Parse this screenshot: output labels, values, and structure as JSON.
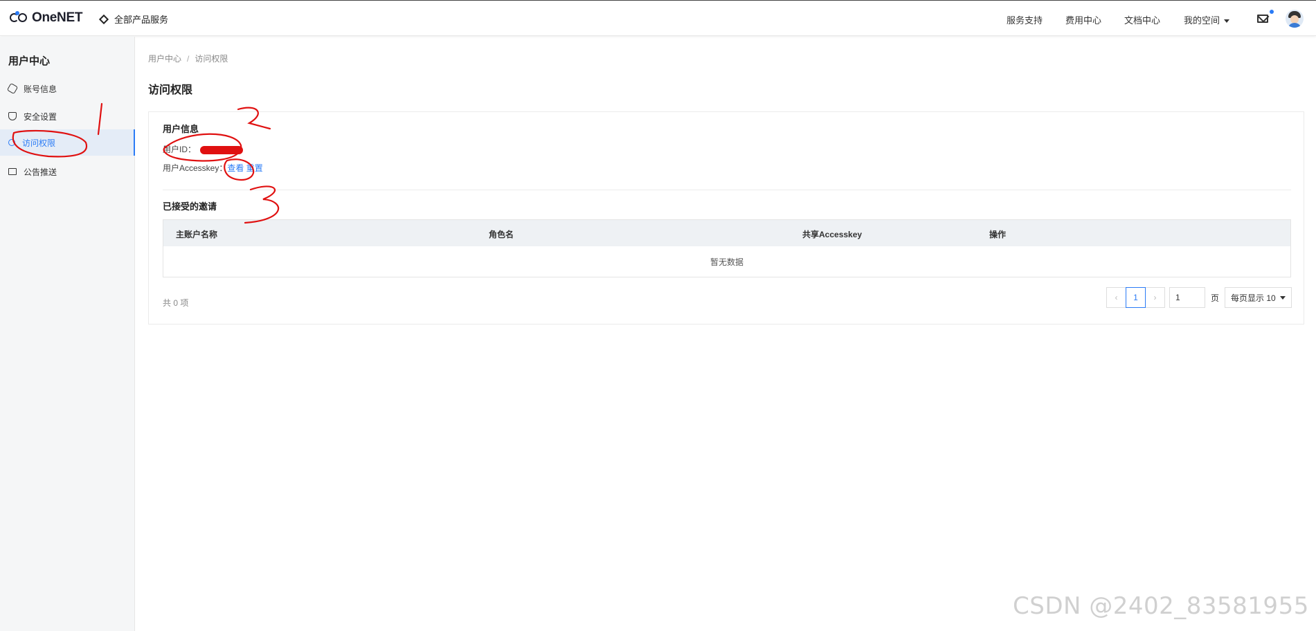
{
  "header": {
    "logo_text": "OneNET",
    "all_products": "全部产品服务",
    "nav": [
      "服务支持",
      "费用中心",
      "文档中心"
    ],
    "my_space": "我的空间"
  },
  "sidebar": {
    "title": "用户中心",
    "items": [
      {
        "label": "账号信息",
        "icon": "hexagon-icon"
      },
      {
        "label": "安全设置",
        "icon": "shield-icon"
      },
      {
        "label": "访问权限",
        "icon": "key-icon",
        "active": true
      },
      {
        "label": "公告推送",
        "icon": "mail-icon"
      }
    ]
  },
  "breadcrumb": {
    "root": "用户中心",
    "sep": "/",
    "current": "访问权限"
  },
  "page_title": "访问权限",
  "user_info": {
    "title": "用户信息",
    "user_id_label": "用户ID：",
    "accesskey_label": "用户Accesskey：",
    "view_link": "查看",
    "reset_link": "重置"
  },
  "invitations": {
    "title": "已接受的邀请",
    "columns": [
      "主账户名称",
      "角色名",
      "共享Accesskey",
      "操作"
    ],
    "empty_text": "暂无数据"
  },
  "pagination": {
    "total": "共 0 项",
    "prev": "‹",
    "current_page": "1",
    "next": "›",
    "jump_value": "1",
    "page_unit": "页",
    "per_page": "每页显示 10"
  },
  "annotations": {
    "marks": [
      "1",
      "2",
      "3"
    ],
    "color": "#e01010"
  },
  "watermark": "CSDN @2402_83581955",
  "colors": {
    "accent": "#2a7bf6",
    "sidebar_bg": "#f5f6f7",
    "table_head_bg": "#eef1f4"
  }
}
